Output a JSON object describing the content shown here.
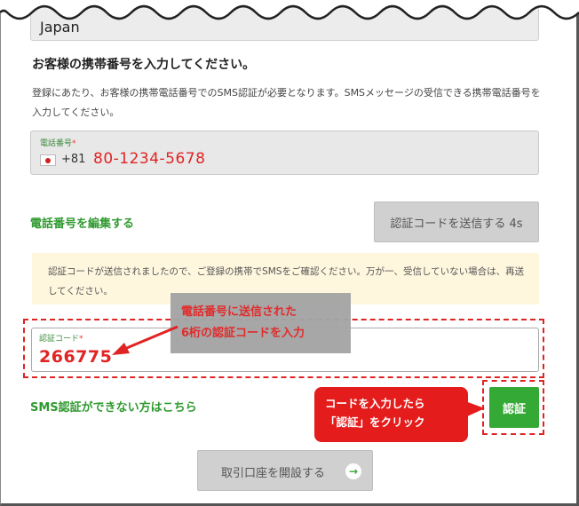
{
  "country_field": {
    "value": "Japan"
  },
  "section": {
    "heading": "お客様の携帯番号を入力してください。",
    "description": "登録にあたり、お客様の携帯電話番号でのSMS認証が必要となります。SMSメッセージの受信できる携帯電話番号を入力してください。"
  },
  "phone_field": {
    "label": "電話番号",
    "required_mark": "*",
    "country_code": "+81",
    "value": "80-1234-5678"
  },
  "edit_phone_link": "電話番号を編集する",
  "send_code_button": "認証コードを送信する 4s",
  "notice": "認証コードが送信されましたので、ご登録の携帯でSMSをご確認ください。万が一、受信していない場合は、再送してください。",
  "code_field": {
    "label": "認証コード",
    "required_mark": "*",
    "value": "266775"
  },
  "callout_code": {
    "line1": "電話番号に送信された",
    "line2": "6桁の認証コードを入力"
  },
  "sms_help_link": "SMS認証ができない方はこちら",
  "callout_verify": {
    "line1": "コードを入力したら",
    "line2": "「認証」をクリック"
  },
  "verify_button": "認証",
  "open_account_button": "取引口座を開設する",
  "icons": {
    "open_account": "arrow-right-circle-icon"
  },
  "colors": {
    "accent_green": "#35a935",
    "annotation_red": "#e02424",
    "notice_bg": "#fff6de"
  }
}
